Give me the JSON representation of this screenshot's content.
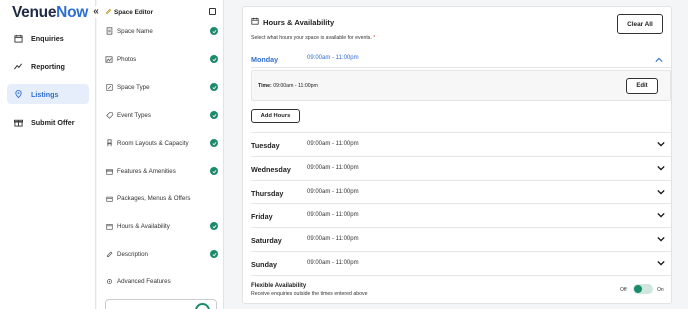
{
  "brand": {
    "part1": "Venue",
    "part2": "Now"
  },
  "nav": {
    "collapse_glyph": "«",
    "items": [
      {
        "label": "Enquiries",
        "icon": "calendar-icon"
      },
      {
        "label": "Reporting",
        "icon": "trend-icon"
      },
      {
        "label": "Listings",
        "icon": "location-pin-icon",
        "active": true
      },
      {
        "label": "Submit Offer",
        "icon": "gift-icon"
      }
    ]
  },
  "editor": {
    "title": "Space Editor",
    "items": [
      {
        "label": "Space Name",
        "complete": true
      },
      {
        "label": "Photos",
        "complete": true
      },
      {
        "label": "Space Type",
        "complete": true
      },
      {
        "label": "Event Types",
        "complete": true
      },
      {
        "label": "Room Layouts & Capacity",
        "complete": true
      },
      {
        "label": "Features & Amenities",
        "complete": true
      },
      {
        "label": "Packages, Menus & Offers",
        "complete": false
      },
      {
        "label": "Hours & Availability",
        "complete": true
      },
      {
        "label": "Description",
        "complete": true
      },
      {
        "label": "Advanced Features",
        "complete": false
      }
    ]
  },
  "hours": {
    "title": "Hours & Availability",
    "subtitle": "Select what hours your space is available for events.",
    "required_mark": "*",
    "clear_all": "Clear All",
    "expanded": {
      "day": "Monday",
      "time": "09:00am - 11:00pm",
      "time_label": "Time:",
      "time_value": "09:00am - 11:00pm",
      "edit": "Edit"
    },
    "add_hours": "Add Hours",
    "days": [
      {
        "day": "Tuesday",
        "time": "09:00am - 11:00pm"
      },
      {
        "day": "Wednesday",
        "time": "09:00am - 11:00pm"
      },
      {
        "day": "Thursday",
        "time": "09:00am - 11:00pm"
      },
      {
        "day": "Friday",
        "time": "09:00am - 11:00pm"
      },
      {
        "day": "Saturday",
        "time": "09:00am - 11:00pm"
      },
      {
        "day": "Sunday",
        "time": "09:00am - 11:00pm"
      }
    ],
    "flexible": {
      "title": "Flexible Availability",
      "subtitle": "Receive enquiries outside the times entered above",
      "off": "Off",
      "on": "On",
      "enabled": true
    }
  },
  "colors": {
    "accent": "#2f6fd1",
    "success": "#1a8a6a",
    "text": "#222222"
  }
}
